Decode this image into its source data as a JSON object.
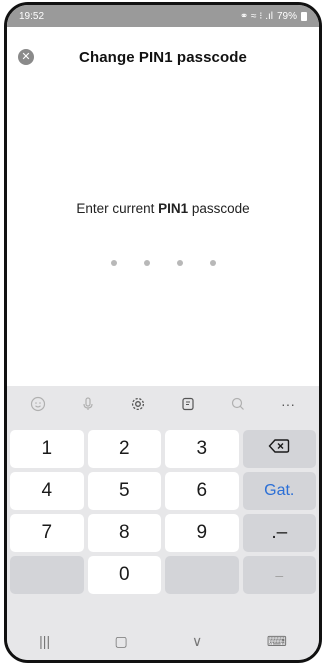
{
  "status": {
    "time": "19:52",
    "icons": "⚭ ≈ ⁝ .ıl",
    "battery": "79%"
  },
  "header": {
    "title": "Change PIN1 passcode",
    "close_icon": "close-icon"
  },
  "prompt": {
    "before": "Enter current ",
    "bold": "PIN1",
    "after": " passcode"
  },
  "pin": {
    "entered": 0,
    "length": 4
  },
  "toolbar": {
    "more": "···"
  },
  "keypad": {
    "k1": "1",
    "k2": "2",
    "k3": "3",
    "k4": "4",
    "k5": "5",
    "k6": "6",
    "go": "Gat.",
    "k7": "7",
    "k8": "8",
    "k9": "9",
    "sym": ".–",
    "k0": "0",
    "minus": "–"
  },
  "nav": {
    "recents": "|||",
    "home": "▢",
    "back": "∨",
    "keyboard": "⌨"
  },
  "colors": {
    "status_bar": "#9a9a9a",
    "keyboard_bg": "#e7e7e9",
    "go_key": "#2b6fd6"
  }
}
